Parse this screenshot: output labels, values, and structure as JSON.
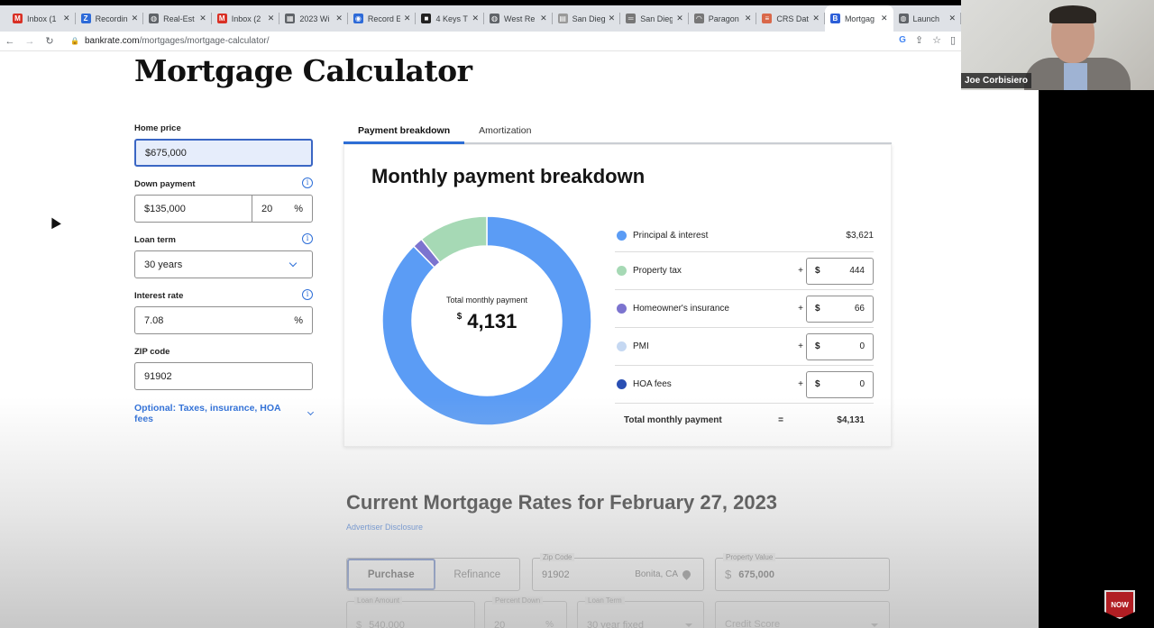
{
  "browser": {
    "tabs": [
      {
        "label": "Inbox (1",
        "icon": "gmail-icon",
        "color": "#d93025",
        "glyph": "M"
      },
      {
        "label": "Recordin",
        "icon": "zoom-icon",
        "color": "#2d6ad8",
        "glyph": "Z"
      },
      {
        "label": "Real-Est",
        "icon": "globe-icon",
        "color": "#5f6368",
        "glyph": "◍"
      },
      {
        "label": "Inbox (2",
        "icon": "gmail-icon",
        "color": "#d93025",
        "glyph": "M"
      },
      {
        "label": "2023 Wi",
        "icon": "calendar-icon",
        "color": "#5f6368",
        "glyph": "▦"
      },
      {
        "label": "Record E",
        "icon": "record-icon",
        "color": "#2d6ad8",
        "glyph": "◉"
      },
      {
        "label": "4 Keys T",
        "icon": "app-icon",
        "color": "#222222",
        "glyph": "■"
      },
      {
        "label": "West Re",
        "icon": "globe-icon",
        "color": "#5f6368",
        "glyph": "◍"
      },
      {
        "label": "San Dieg",
        "icon": "sdmls-icon",
        "color": "#999999",
        "glyph": "▤"
      },
      {
        "label": "San Dieg",
        "icon": "car-icon",
        "color": "#777777",
        "glyph": "═"
      },
      {
        "label": "Paragon",
        "icon": "paragon-icon",
        "color": "#777777",
        "glyph": "◠"
      },
      {
        "label": "CRS Dat",
        "icon": "crs-icon",
        "color": "#d9684a",
        "glyph": "≡"
      },
      {
        "label": "Mortgag",
        "icon": "bankrate-icon",
        "color": "#2d5fd8",
        "glyph": "B",
        "active": true
      },
      {
        "label": "Launch",
        "icon": "globe-icon",
        "color": "#5f6368",
        "glyph": "◍"
      }
    ],
    "url_domain": "bankrate.com",
    "url_path": "/mortgages/mortgage-calculator/",
    "close_glyph": "✕"
  },
  "page": {
    "title": "Mortgage Calculator",
    "form": {
      "home_price_label": "Home price",
      "home_price_value": "$675,000",
      "down_payment_label": "Down payment",
      "down_payment_value": "$135,000",
      "down_payment_percent": "20",
      "percent_sign": "%",
      "loan_term_label": "Loan term",
      "loan_term_value": "30 years",
      "interest_rate_label": "Interest rate",
      "interest_rate_value": "7.08",
      "zip_label": "ZIP code",
      "zip_value": "91902",
      "optional_link": "Optional: Taxes, insurance, HOA fees"
    },
    "tabs": [
      "Payment breakdown",
      "Amortization"
    ],
    "breakdown": {
      "title": "Monthly payment breakdown",
      "center_label": "Total monthly payment",
      "center_currency": "$",
      "center_value": "4,131",
      "rows": [
        {
          "label": "Principal & interest",
          "value": "$3,621",
          "color": "#5b9cf5"
        },
        {
          "label": "Property tax",
          "plus": "+",
          "currency": "$",
          "value": "444",
          "color": "#a6d9b5"
        },
        {
          "label": "Homeowner's insurance",
          "plus": "+",
          "currency": "$",
          "value": "66",
          "color": "#7c74cf"
        },
        {
          "label": "PMI",
          "plus": "+",
          "currency": "$",
          "value": "0",
          "color": "#c5d8f2"
        },
        {
          "label": "HOA fees",
          "plus": "+",
          "currency": "$",
          "value": "0",
          "color": "#2a4fb3"
        }
      ],
      "total_label": "Total monthly payment",
      "total_eq": "=",
      "total_value": "$4,131"
    },
    "rates": {
      "title": "Current Mortgage Rates for February 27, 2023",
      "disclosure": "Advertiser Disclosure",
      "purchase": "Purchase",
      "refinance": "Refinance",
      "zip_label": "Zip Code",
      "zip_value": "91902",
      "location": "Bonita, CA",
      "property_label": "Property Value",
      "property_currency": "$",
      "property_value": "675,000",
      "loan_amount_label": "Loan Amount",
      "loan_amount_currency": "$",
      "loan_amount_value": "540,000",
      "percent_down_label": "Percent Down",
      "percent_down_value": "20",
      "percent_sign": "%",
      "loan_term_label": "Loan Term",
      "loan_term_value": "30 year fixed",
      "credit_score_label": "Credit Score"
    }
  },
  "webcam": {
    "name": "Joe Corbisiero"
  },
  "subscribe_badge": "NOW",
  "chart_data": {
    "type": "pie",
    "variant": "donut",
    "title": "Monthly payment breakdown",
    "center_text": "Total monthly payment $4,131",
    "categories": [
      "Principal & interest",
      "Homeowner's insurance",
      "Property tax",
      "PMI",
      "HOA fees"
    ],
    "values": [
      3621,
      66,
      444,
      0,
      0
    ],
    "colors": [
      "#5b9cf5",
      "#7c74cf",
      "#a6d9b5",
      "#c5d8f2",
      "#2a4fb3"
    ],
    "total": 4131,
    "legend": "right"
  }
}
